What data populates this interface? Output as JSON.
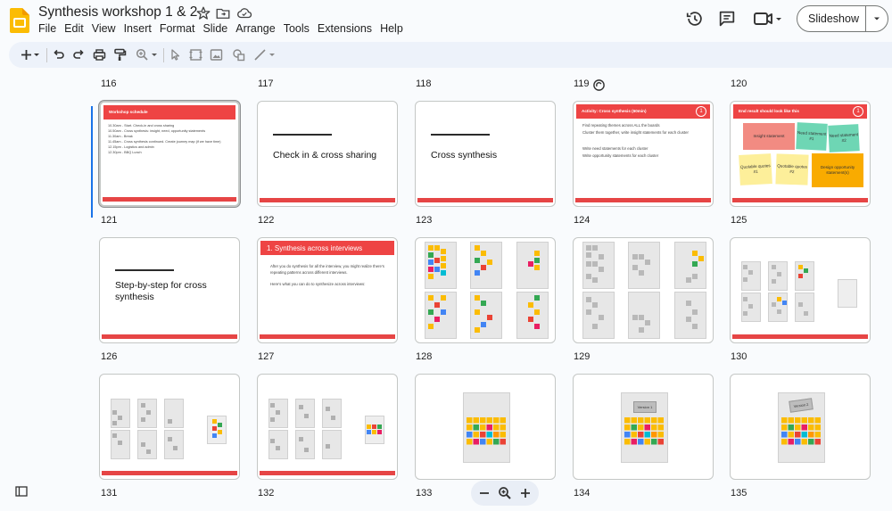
{
  "app": {
    "doc_title": "Synthesis workshop 1 & 2 -",
    "menu": [
      "File",
      "Edit",
      "View",
      "Insert",
      "Format",
      "Slide",
      "Arrange",
      "Tools",
      "Extensions",
      "Help"
    ],
    "slideshow_label": "Slideshow",
    "icons": {
      "logo": "slides-logo-icon",
      "star": "star-icon",
      "move": "move-to-folder-icon",
      "cloud": "cloud-status-icon",
      "history": "version-history-icon",
      "comments": "comments-icon",
      "meet": "meet-camera-icon"
    },
    "colors": {
      "accent": "#fbbc04",
      "slide_red": "#e64545",
      "selection": "#1a73e8"
    }
  },
  "toolbar": {
    "icons": [
      "new-slide-icon",
      "dropdown-icon",
      "undo-icon",
      "redo-icon",
      "print-icon",
      "paint-format-icon",
      "zoom-icon",
      "dropdown-icon",
      "select-icon",
      "frame-icon",
      "image-icon",
      "shape-icon",
      "line-icon",
      "dropdown-icon"
    ]
  },
  "grid": {
    "row_labels_top": [
      "116",
      "117",
      "118",
      "119",
      "120"
    ],
    "row1_labels": [
      "121",
      "122",
      "123",
      "124",
      "125"
    ],
    "row2_labels": [
      "126",
      "127",
      "128",
      "129",
      "130"
    ],
    "row3_labels": [
      "131",
      "132",
      "133",
      "134",
      "135"
    ],
    "slides": {
      "s121": {
        "heading": "Workshop schedule",
        "lines": [
          "10.30am - Start. Check-in and cross sharing",
          "10.50am - Cross synthesis: insight, need, opportunity statements",
          "11.30am - Break",
          "11.45am - Cross synthesis continued. Create journey map (if we have time)",
          "12.15pm - Logistics and admin",
          "12.30pm - BBQ Lunch"
        ]
      },
      "s122": {
        "text": "Check in & cross sharing"
      },
      "s123": {
        "text": "Cross synthesis"
      },
      "s124": {
        "heading": "Activity: Cross synthesis (60min)",
        "badge": "1",
        "bullets": [
          "Find repeating themes across ALL the boards",
          "Cluster them together, write insight statements for each cluster",
          "Write need statements for each cluster",
          "Write opportunity statements for each cluster"
        ]
      },
      "s125": {
        "heading": "End result should look like this",
        "badge": "1",
        "notes": [
          "Insight statement",
          "Need statement #1",
          "Need statement #2",
          "Quotable quotes #1",
          "Quotable quotes #2",
          "Design opportunity statement(s)"
        ]
      },
      "s126": {
        "text": "Step-by-step for cross synthesis"
      },
      "s127": {
        "heading": "1. Synthesis across interviews",
        "lines": [
          "After you do synthesis for all the interview, you might realize there's repeating patterns across different interviews.",
          "Here's what you can do to synthesize across interviews:"
        ]
      },
      "s134": {
        "tag": "Version 1"
      },
      "s135": {
        "tag": "Version 2"
      }
    }
  },
  "zoom": {
    "icons": [
      "zoom-out-icon",
      "zoom-in-icon",
      "zoom-add-icon"
    ]
  }
}
